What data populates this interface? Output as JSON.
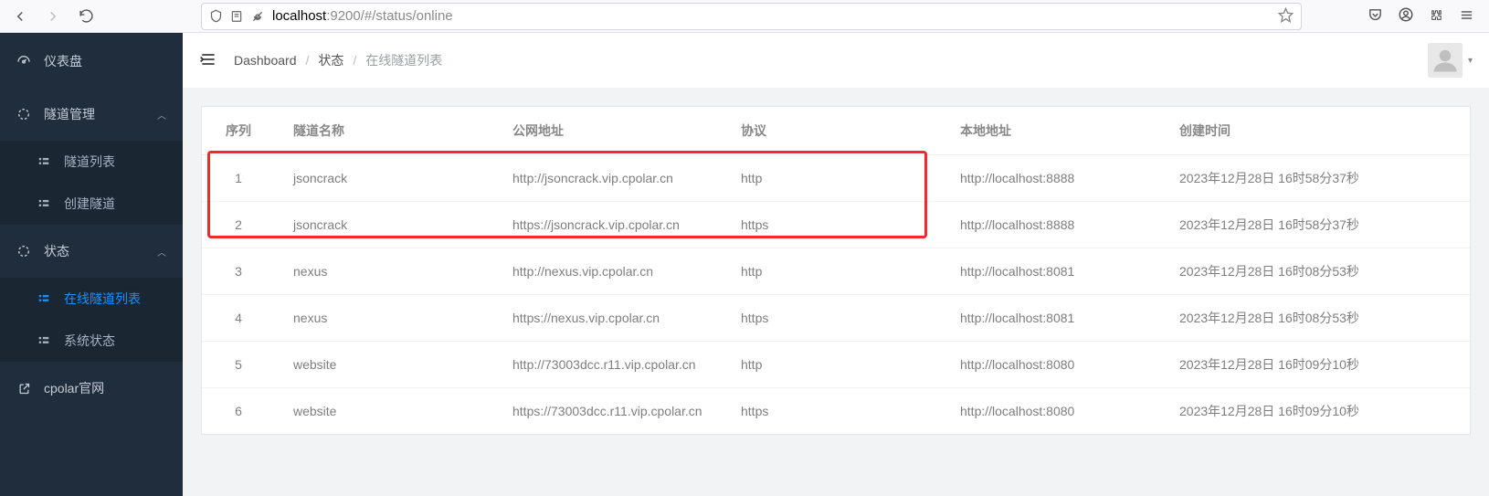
{
  "browser": {
    "url_host": "localhost",
    "url_rest": ":9200/#/status/online"
  },
  "sidebar": {
    "dashboard": "仪表盘",
    "tunnel_mgmt": "隧道管理",
    "tunnel_list": "隧道列表",
    "create_tunnel": "创建隧道",
    "status": "状态",
    "online_tunnels": "在线隧道列表",
    "system_status": "系统状态",
    "cpolar_site": "cpolar官网"
  },
  "breadcrumb": {
    "dashboard": "Dashboard",
    "status": "状态",
    "current": "在线隧道列表"
  },
  "table": {
    "headers": {
      "index": "序列",
      "name": "隧道名称",
      "url": "公网地址",
      "protocol": "协议",
      "local": "本地地址",
      "created": "创建时间"
    },
    "rows": [
      {
        "idx": "1",
        "name": "jsoncrack",
        "url": "http://jsoncrack.vip.cpolar.cn",
        "protocol": "http",
        "local": "http://localhost:8888",
        "created": "2023年12月28日 16时58分37秒"
      },
      {
        "idx": "2",
        "name": "jsoncrack",
        "url": "https://jsoncrack.vip.cpolar.cn",
        "protocol": "https",
        "local": "http://localhost:8888",
        "created": "2023年12月28日 16时58分37秒"
      },
      {
        "idx": "3",
        "name": "nexus",
        "url": "http://nexus.vip.cpolar.cn",
        "protocol": "http",
        "local": "http://localhost:8081",
        "created": "2023年12月28日 16时08分53秒"
      },
      {
        "idx": "4",
        "name": "nexus",
        "url": "https://nexus.vip.cpolar.cn",
        "protocol": "https",
        "local": "http://localhost:8081",
        "created": "2023年12月28日 16时08分53秒"
      },
      {
        "idx": "5",
        "name": "website",
        "url": "http://73003dcc.r11.vip.cpolar.cn",
        "protocol": "http",
        "local": "http://localhost:8080",
        "created": "2023年12月28日 16时09分10秒"
      },
      {
        "idx": "6",
        "name": "website",
        "url": "https://73003dcc.r11.vip.cpolar.cn",
        "protocol": "https",
        "local": "http://localhost:8080",
        "created": "2023年12月28日 16时09分10秒"
      }
    ]
  }
}
